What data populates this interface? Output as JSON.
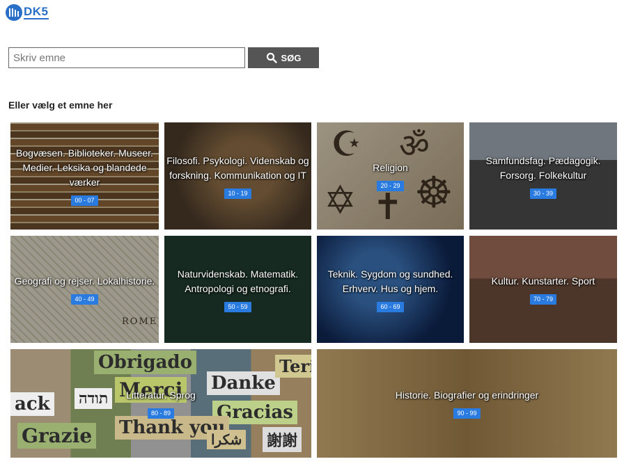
{
  "brand": {
    "logo_text": "DK5"
  },
  "search": {
    "placeholder": "Skriv emne",
    "button_label": "SØG"
  },
  "section": {
    "heading": "Eller vælg et emne her"
  },
  "tiles": [
    {
      "label": "Bogvæsen. Biblioteker. Museer. Medier. Leksika og blandede værker",
      "range": "00 - 07"
    },
    {
      "label": "Filosofi. Psykologi. Videnskab og forskning. Kommunikation og IT",
      "range": "10 - 19"
    },
    {
      "label": "Religion",
      "range": "20 - 29"
    },
    {
      "label": "Samfundsfag. Pædagogik. Forsorg. Folkekultur",
      "range": "30 - 39"
    },
    {
      "label": "Geografi og rejser. Lokalhistorie.",
      "range": "40 - 49"
    },
    {
      "label": "Naturvidenskab. Matematik. Antropologi og etnografi.",
      "range": "50 - 59"
    },
    {
      "label": "Teknik. Sygdom og sundhed. Erhverv. Hus og hjem.",
      "range": "60 - 69"
    },
    {
      "label": "Kultur. Kunstarter. Sport",
      "range": "70 - 79"
    },
    {
      "label": "Litteratur. Sprog",
      "range": "80 - 89"
    },
    {
      "label": "Historie. Biografier og erindringer",
      "range": "90 - 99"
    }
  ],
  "decor": {
    "religion_symbols": [
      "☪",
      "ॐ",
      "✡",
      "✝",
      "☸"
    ],
    "language_words": [
      "Obrigado",
      "Merci",
      "Danke",
      "Gracias",
      "Grazie",
      "Thank you",
      "תודה",
      "謝謝",
      "شكرا",
      "Teri",
      "ack"
    ],
    "geo_word": "ROME"
  },
  "colors": {
    "badge": "#2a7be0",
    "search_button": "#555555",
    "logo": "#2a6fc7"
  }
}
